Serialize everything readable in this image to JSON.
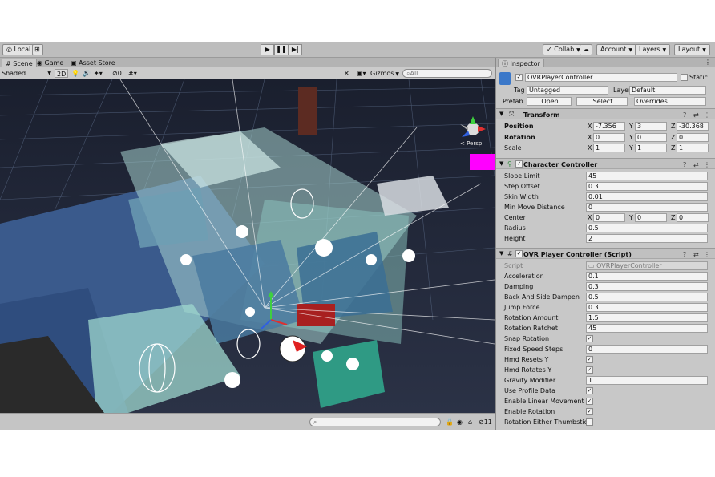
{
  "toolbar": {
    "pivot": "Local",
    "collab": "Collab",
    "account": "Account",
    "layers": "Layers",
    "layout": "Layout",
    "play": "▶",
    "pause": "❚❚",
    "step": "▶|"
  },
  "scene_tabs": [
    "Scene",
    "Game",
    "Asset Store"
  ],
  "scene_bar": {
    "draw_mode": "Shaded",
    "mode_2d": "2D",
    "hidden_count": "0",
    "gizmos": "Gizmos",
    "search_placeholder": "All"
  },
  "viewport": {
    "persp_label": "< Persp"
  },
  "bottom_bar": {
    "layer_count": "11"
  },
  "inspector": {
    "tab": "Inspector",
    "object_name": "OVRPlayerController",
    "static_label": "Static",
    "tag_label": "Tag",
    "tag_value": "Untagged",
    "layer_label": "Layer",
    "layer_value": "Default",
    "prefab_label": "Prefab",
    "open": "Open",
    "select": "Select",
    "overrides": "Overrides",
    "transform": {
      "title": "Transform",
      "position_label": "Position",
      "position": {
        "x": "-7.356",
        "y": "3",
        "z": "-30.368"
      },
      "rotation_label": "Rotation",
      "rotation": {
        "x": "0",
        "y": "0",
        "z": "0"
      },
      "scale_label": "Scale",
      "scale": {
        "x": "1",
        "y": "1",
        "z": "1"
      }
    },
    "character_controller": {
      "title": "Character Controller",
      "rows": [
        {
          "label": "Slope Limit",
          "value": "45"
        },
        {
          "label": "Step Offset",
          "value": "0.3"
        },
        {
          "label": "Skin Width",
          "value": "0.01"
        },
        {
          "label": "Min Move Distance",
          "value": "0"
        }
      ],
      "center_label": "Center",
      "center": {
        "x": "0",
        "y": "0",
        "z": "0"
      },
      "radius_label": "Radius",
      "radius": "0.5",
      "height_label": "Height",
      "height": "2"
    },
    "ovr_controller": {
      "title": "OVR Player Controller (Script)",
      "script_label": "Script",
      "script_value": "OVRPlayerController",
      "rows": [
        {
          "label": "Acceleration",
          "value": "0.1"
        },
        {
          "label": "Damping",
          "value": "0.3"
        },
        {
          "label": "Back And Side Dampen",
          "value": "0.5"
        },
        {
          "label": "Jump Force",
          "value": "0.3"
        },
        {
          "label": "Rotation Amount",
          "value": "1.5"
        },
        {
          "label": "Rotation Ratchet",
          "value": "45"
        }
      ],
      "snap_rotation_label": "Snap Rotation",
      "fixed_speed_label": "Fixed Speed Steps",
      "fixed_speed_value": "0",
      "hmd_resets_label": "Hmd Resets Y",
      "hmd_rotates_label": "Hmd Rotates Y",
      "gravity_label": "Gravity Modifier",
      "gravity_value": "1",
      "profile_label": "Use Profile Data",
      "linear_label": "Enable Linear Movement",
      "rotation_label": "Enable Rotation",
      "thumbstick_label": "Rotation Either Thumbstick"
    }
  },
  "colors": {
    "viewport_bg": "#22283a",
    "floor": "#3a5a8c",
    "wall_glass": "#a8d4d0",
    "accent_magenta": "#ff00ff"
  }
}
